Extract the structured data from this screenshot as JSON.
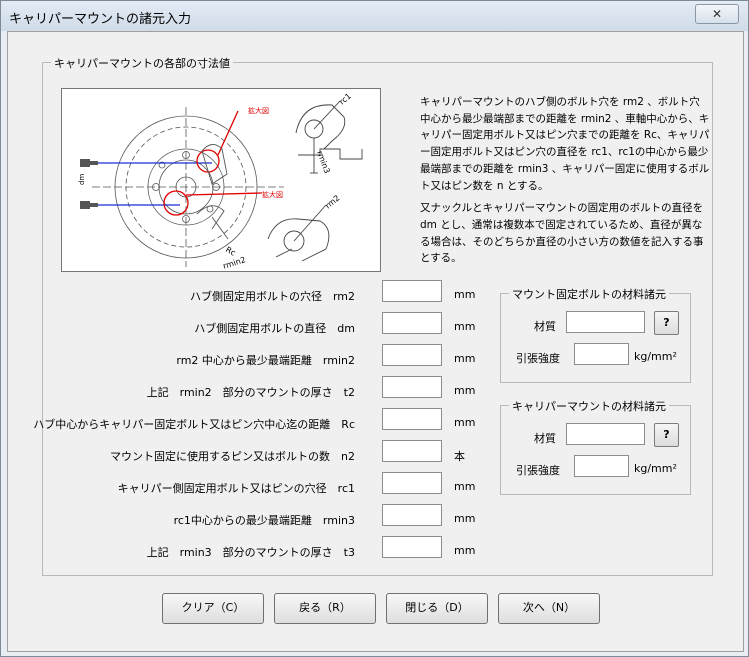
{
  "window": {
    "title": "キャリパーマウントの諸元入力",
    "close_glyph": "✕"
  },
  "dimensions_group": {
    "title": "キャリパーマウントの各部の寸法値"
  },
  "diagram": {
    "label_kakudai_1": "拡大図",
    "label_kakudai_2": "拡大図",
    "label_rc": "Rc",
    "label_dm": "dm",
    "label_rm2": "rm2",
    "label_rc1": "rc1",
    "label_rmin3": "rmin3",
    "label_rm2b": "rm2",
    "label_rmin2": "rmin2"
  },
  "description": {
    "para1": "キャリパーマウントのハブ側のボルト穴を rm2 、ボルト穴中心から最少最端部までの距離を rmin2 、車軸中心から、キャリパー固定用ボルト又はピン穴までの距離を Rc、キャリパー固定用ボルト又はピン穴の直径を rc1、rc1の中心から最少最端部までの距離を rmin3 、キャリパー固定に使用するボルト又はピン数を n とする。",
    "para2": "又ナックルとキャリパーマウントの固定用のボルトの直径を dm とし、通常は複数本で固定されているため、直径が異なる場合は、そのどちらか直径の小さい方の数値を記入する事とする。"
  },
  "fields": [
    {
      "label": "ハブ側固定用ボルトの穴径　rm2",
      "value": "",
      "unit": "mm"
    },
    {
      "label": "ハブ側固定用ボルトの直径　dm",
      "value": "",
      "unit": "mm"
    },
    {
      "label": "rm2 中心から最少最端距離　rmin2",
      "value": "",
      "unit": "mm"
    },
    {
      "label": "上記　rmin2　部分のマウントの厚さ　t2",
      "value": "",
      "unit": "mm"
    },
    {
      "label": "ハブ中心からキャリパー固定ボルト又はピン穴中心迄の距離　Rc",
      "value": "",
      "unit": "mm"
    },
    {
      "label": "マウント固定に使用するピン又はボルトの数　n2",
      "value": "",
      "unit": "本"
    },
    {
      "label": "キャリパー側固定用ボルト又はピンの穴径　rc1",
      "value": "",
      "unit": "mm"
    },
    {
      "label": "rc1中心からの最少最端距離　rmin3",
      "value": "",
      "unit": "mm"
    },
    {
      "label": "上記　rmin3　部分のマウントの厚さ　t3",
      "value": "",
      "unit": "mm"
    }
  ],
  "mount_bolt_material": {
    "title": "マウント固定ボルトの材料諸元",
    "material_label": "材質",
    "material_value": "",
    "help_label": "?",
    "tensile_label": "引張強度",
    "tensile_value": "",
    "tensile_unit": "kg/mm²"
  },
  "caliper_mount_material": {
    "title": "キャリパーマウントの材料諸元",
    "material_label": "材質",
    "material_value": "",
    "help_label": "?",
    "tensile_label": "引張強度",
    "tensile_value": "",
    "tensile_unit": "kg/mm²"
  },
  "buttons": {
    "clear": "クリア（C）",
    "back": "戻る（R）",
    "close": "閉じる（D）",
    "next": "次へ（N）"
  },
  "colors": {
    "accent_red": "#e00000",
    "line_blue": "#1a2fd0"
  }
}
